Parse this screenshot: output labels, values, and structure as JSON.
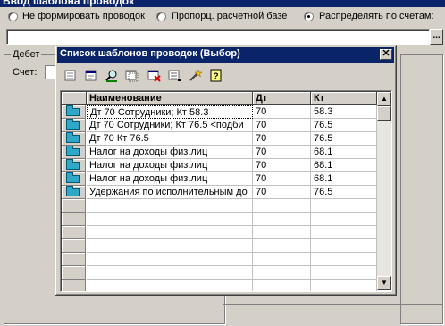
{
  "outer": {
    "title": "Ввод шаблона проводок",
    "radios": [
      {
        "label": "Не формировать проводок",
        "selected": false
      },
      {
        "label": "Пропорц. расчетной базе",
        "selected": false
      },
      {
        "label": "Распределять по счетам:",
        "selected": true
      }
    ],
    "ellipsis": "...",
    "debet_label": "Дебет",
    "schet_label": "Счет:"
  },
  "dialog": {
    "title": "Список шаблонов проводок (Выбор)",
    "close": "✕",
    "toolbar": [
      "new-doc-icon",
      "edit-doc-icon",
      "find-icon",
      "copy-icon",
      "delete-icon",
      "list-icon",
      "wand-icon",
      "help-icon"
    ],
    "columns": [
      "Наименование",
      "Дт",
      "Кт"
    ],
    "rows": [
      {
        "name": "Дт  70 Сотрудники; Кт  58.3",
        "dt": "70",
        "kt": "58.3",
        "selected": true
      },
      {
        "name": "Дт  70 Сотрудники; Кт  76.5 <подби",
        "dt": "70",
        "kt": "76.5"
      },
      {
        "name": "Дт 70 Кт 76.5",
        "dt": "70",
        "kt": "76.5"
      },
      {
        "name": "Налог на доходы физ.лиц",
        "dt": "70",
        "kt": "68.1"
      },
      {
        "name": "Налог на доходы физ.лиц",
        "dt": "70",
        "kt": "68.1"
      },
      {
        "name": "Налог на доходы физ.лиц",
        "dt": "70",
        "kt": "68.1"
      },
      {
        "name": "Удержания по исполнительным до",
        "dt": "70",
        "kt": "76.5"
      }
    ],
    "empty_rows": 7
  }
}
